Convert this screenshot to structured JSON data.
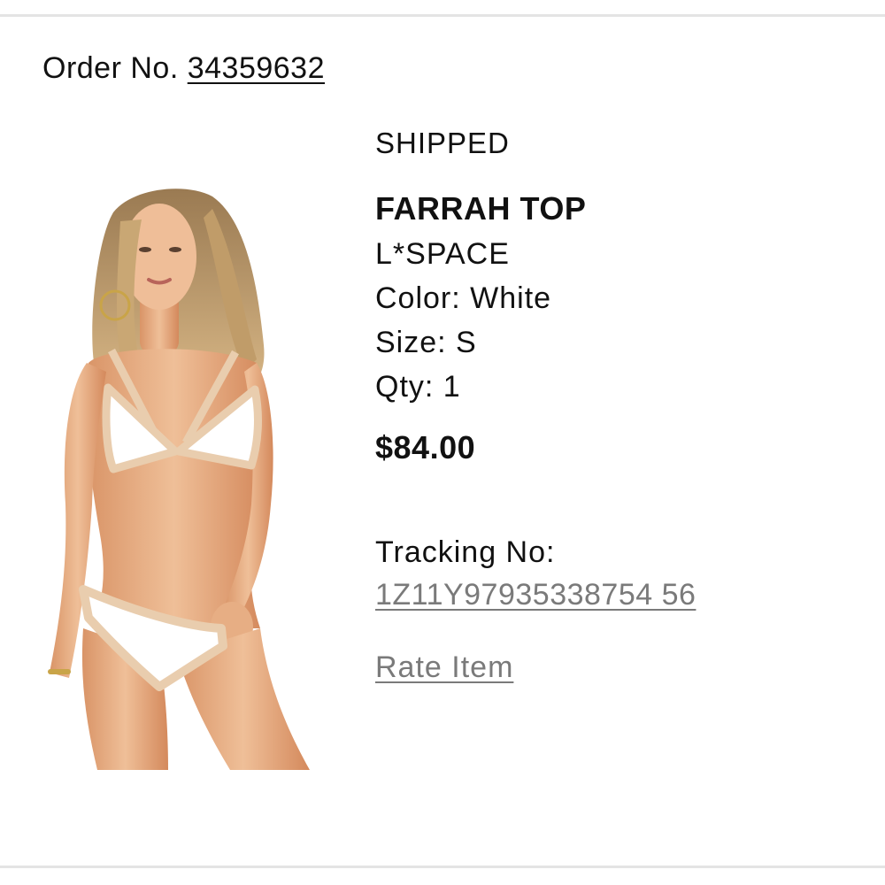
{
  "order": {
    "label": "Order No.",
    "number": "34359632"
  },
  "item": {
    "status": "SHIPPED",
    "name": "FARRAH TOP",
    "brand": "L*SPACE",
    "color_label": "Color: White",
    "size_label": "Size: S",
    "qty_label": "Qty: 1",
    "price": "$84.00",
    "image_icon": "product-photo",
    "swatch_colors": {
      "fabric": "#ffffff",
      "trim": "#e9cdae",
      "skin": "#e2a57b"
    }
  },
  "tracking": {
    "label": "Tracking No:",
    "number": "1Z11Y97935338754 56"
  },
  "actions": {
    "rate_item": "Rate Item"
  }
}
